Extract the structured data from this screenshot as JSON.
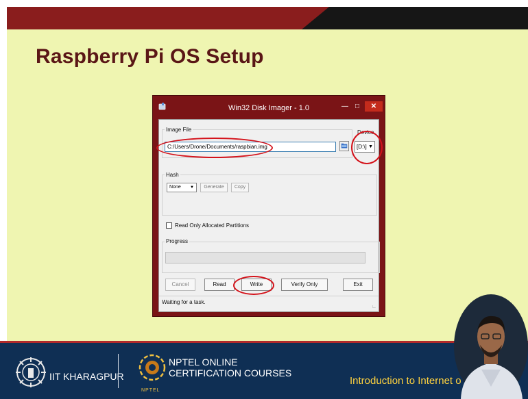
{
  "slide": {
    "title": "Raspberry Pi OS Setup",
    "course": "Introduction to Internet o",
    "footer_left": "IIT KHARAGPUR",
    "footer_nptel_line1": "NPTEL ONLINE",
    "footer_nptel_line2": "CERTIFICATION COURSES",
    "nptel_small": "NPTEL"
  },
  "window": {
    "title": "Win32 Disk Imager - 1.0",
    "image_file_label": "Image File",
    "image_path": "C:/Users/Drone/Documents/raspbian.img",
    "device_label": "Device",
    "device_value": "[D:\\]",
    "hash_label": "Hash",
    "hash_value": "None",
    "generate_label": "Generate",
    "copy_label": "Copy",
    "read_only_label": "Read Only Allocated Partitions",
    "progress_label": "Progress",
    "progress_fraction": 0,
    "buttons": {
      "cancel": "Cancel",
      "read": "Read",
      "write": "Write",
      "verify": "Verify Only",
      "exit": "Exit"
    },
    "status": "Waiting for a task."
  },
  "colors": {
    "slide_bg": "#eff5b1",
    "title": "#5a1616",
    "window_frame": "#7a1416",
    "annotation": "#d4121a",
    "footer": "#0f2f54",
    "course_text": "#ffd23f"
  },
  "icons": {
    "app": "disk-imager-icon",
    "folder": "folder-icon",
    "dropdown": "chevron-down-icon"
  }
}
